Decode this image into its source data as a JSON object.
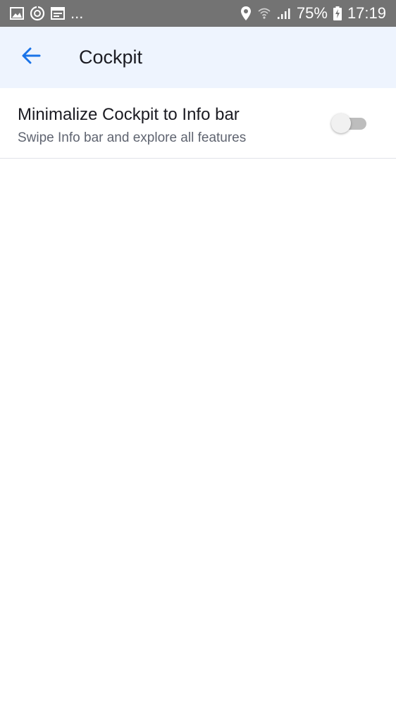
{
  "status_bar": {
    "left_icons": [
      "image-icon",
      "sync-icon",
      "calendar-icon"
    ],
    "overflow": "...",
    "battery_percent": "75%",
    "time": "17:19"
  },
  "app_bar": {
    "title": "Cockpit",
    "back_icon": "arrow-left-icon"
  },
  "settings": {
    "minimize": {
      "title": "Minimalize Cockpit to Info bar",
      "subtitle": "Swipe Info bar and explore all features",
      "enabled": false
    }
  },
  "colors": {
    "status_bar_bg": "#737373",
    "app_bar_bg": "#eef4fe",
    "accent": "#1a73e8"
  }
}
